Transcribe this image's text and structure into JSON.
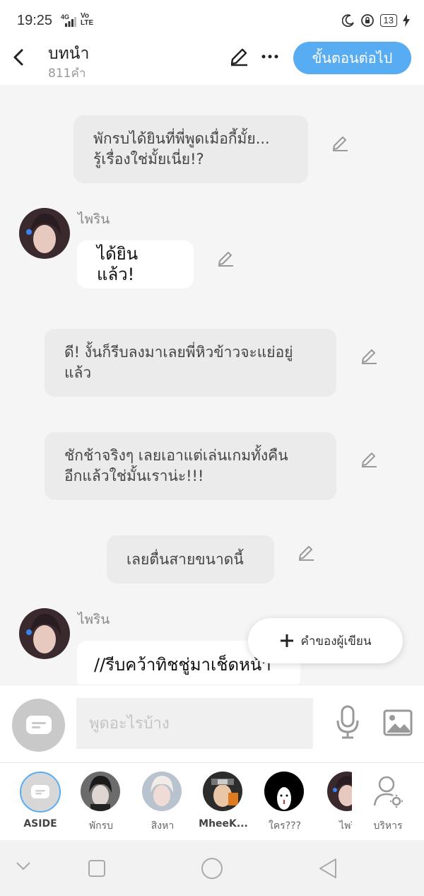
{
  "status_bar": {
    "time": "19:25",
    "network": "4G",
    "volte": "Vo\nLTE",
    "battery": "13"
  },
  "header": {
    "title": "บทนำ",
    "word_count": "811คำ",
    "next_button": "ขั้นตอนต่อไป"
  },
  "messages": [
    {
      "type": "narration",
      "text": "พักรบได้ยินที่พี่พูดเมื่อกี้มั้ย...\nรู้เรื่องใช่มั้ยเนี่ย!?"
    },
    {
      "type": "character",
      "name": "ไพริน",
      "text": "ได้ยินแล้ว!"
    },
    {
      "type": "narration",
      "text": "ดี! งั้นก็รีบลงมาเลยพี่หิวข้าวจะแย่อยู่\nแล้ว"
    },
    {
      "type": "narration",
      "text": "ชักช้าจริงๆ เลยเอาแต่เล่นเกมทั้งคืน\nอีกแล้วใช่มั้นเราน่ะ!!!"
    },
    {
      "type": "narration",
      "text": "เลยตื่นสายขนาดนี้"
    },
    {
      "type": "character",
      "name": "ไพริน",
      "text": "//รีบคว้าทิชชู่มาเช็ดหน้า"
    }
  ],
  "writer_button": "คำของผู้เขียน",
  "input": {
    "placeholder": "พูดอะไรบ้าง"
  },
  "characters": [
    {
      "label": "ASIDE"
    },
    {
      "label": "พักรบ"
    },
    {
      "label": "สิงหา"
    },
    {
      "label": "MheeK..."
    },
    {
      "label": "ใคร???"
    },
    {
      "label": "ไพริ"
    },
    {
      "label": "บริหาร"
    }
  ],
  "colors": {
    "accent": "#58adf2",
    "narration_bg": "#ebebeb",
    "background": "#f5f5f5"
  }
}
